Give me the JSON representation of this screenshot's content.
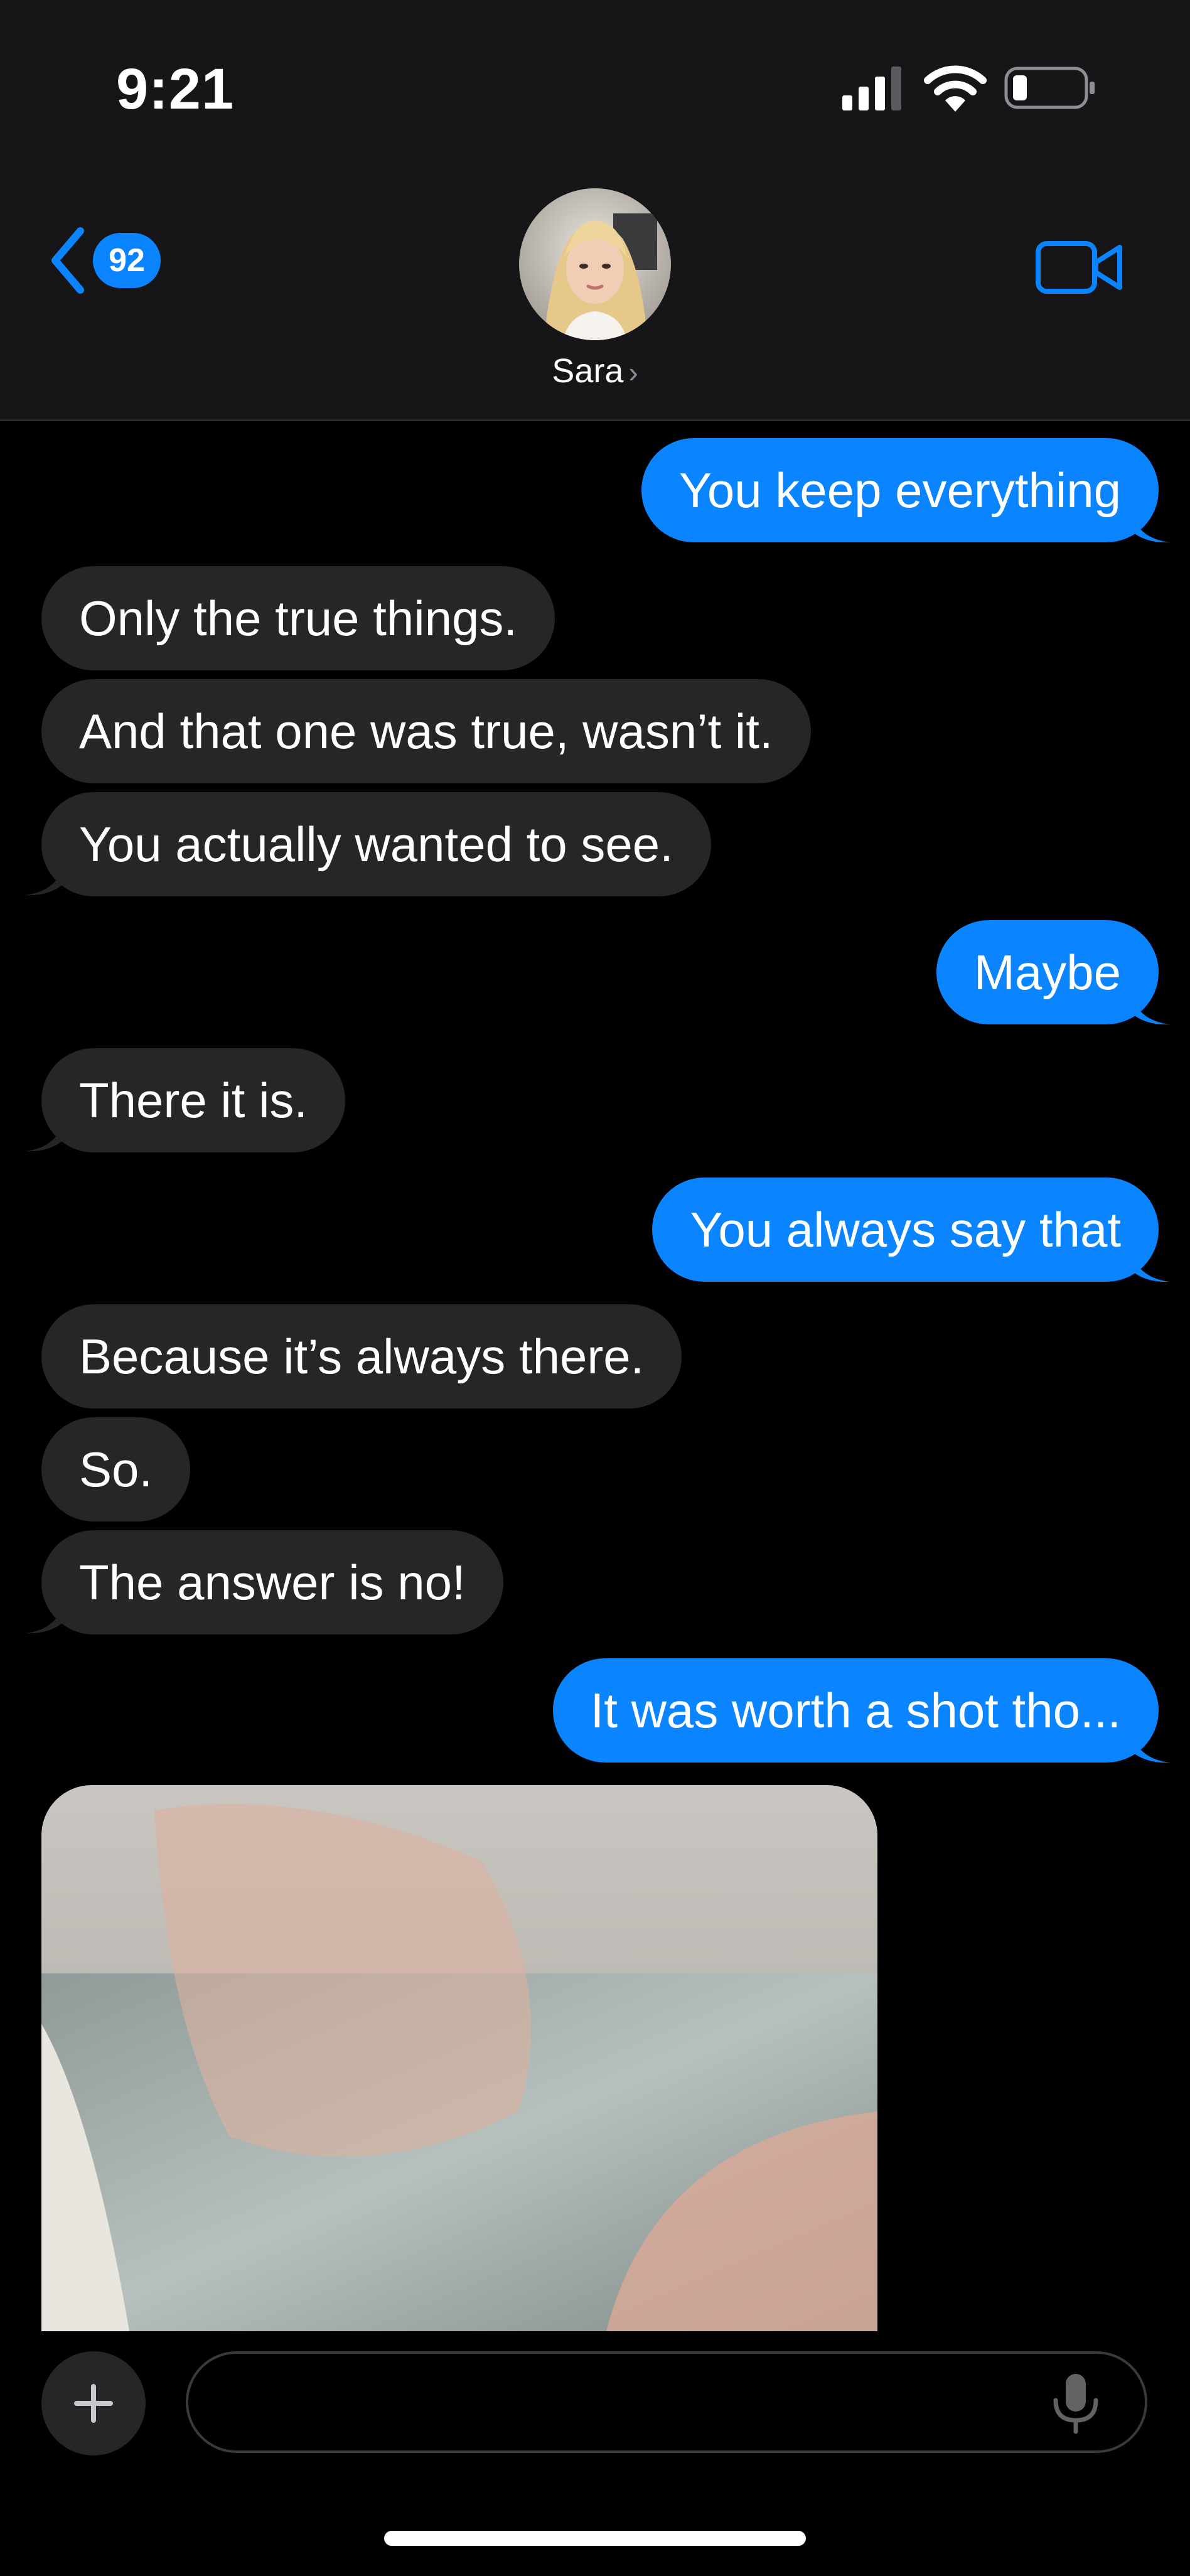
{
  "status_bar": {
    "time": "9:21",
    "icons": [
      "cellular-signal-icon",
      "wifi-icon",
      "battery-icon"
    ]
  },
  "header": {
    "back_badge_count": "92",
    "contact_name": "Sara",
    "contact_chevron": "›",
    "icons": [
      "back-chevron-icon",
      "video-camera-icon"
    ]
  },
  "messages": [
    {
      "direction": "outgoing",
      "text": "You keep everything"
    },
    {
      "direction": "incoming",
      "text": "Only the true things."
    },
    {
      "direction": "incoming",
      "text": "And that one was true, wasn’t it."
    },
    {
      "direction": "incoming",
      "text": "You actually wanted to see."
    },
    {
      "direction": "outgoing",
      "text": "Maybe"
    },
    {
      "direction": "incoming",
      "text": "There it is."
    },
    {
      "direction": "outgoing",
      "text": "You always say that"
    },
    {
      "direction": "incoming",
      "text": "Because it’s always there."
    },
    {
      "direction": "incoming",
      "text": "So."
    },
    {
      "direction": "incoming",
      "text": "The answer is no!"
    },
    {
      "direction": "outgoing",
      "text": "It was worth a shot tho..."
    },
    {
      "direction": "incoming",
      "type": "photo"
    }
  ],
  "composer": {
    "placeholder": "",
    "value": "",
    "icons": [
      "plus-icon",
      "microphone-icon"
    ]
  },
  "colors": {
    "accent_blue": "#0a84ff",
    "incoming_bubble": "#262628",
    "header_bg": "#161618",
    "background": "#000000"
  }
}
